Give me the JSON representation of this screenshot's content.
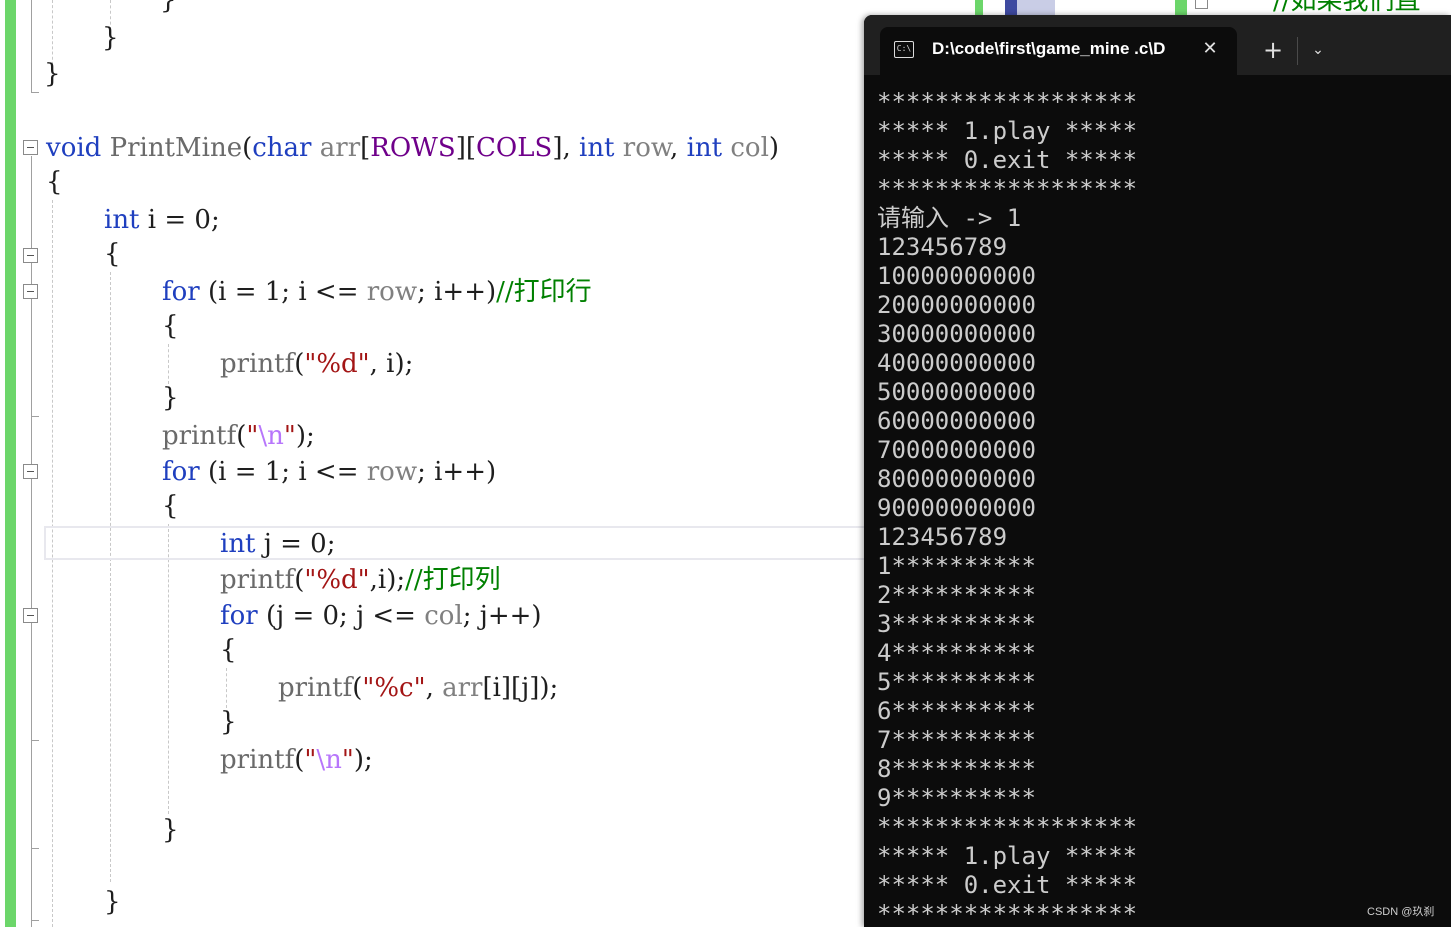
{
  "editor": {
    "lines": [
      [
        {
          "t": "}",
          "c": "p"
        }
      ],
      [
        {
          "t": "}",
          "c": "p"
        }
      ],
      [
        {
          "t": "}",
          "c": "p"
        }
      ],
      [
        {
          "t": "void",
          "c": "kw"
        },
        {
          "t": " ",
          "c": "p"
        },
        {
          "t": "PrintMine",
          "c": "fn"
        },
        {
          "t": "(",
          "c": "p"
        },
        {
          "t": "char",
          "c": "kw"
        },
        {
          "t": " ",
          "c": "p"
        },
        {
          "t": "arr",
          "c": "va"
        },
        {
          "t": "[",
          "c": "p"
        },
        {
          "t": "ROWS",
          "c": "mac"
        },
        {
          "t": "][",
          "c": "p"
        },
        {
          "t": "COLS",
          "c": "mac"
        },
        {
          "t": "], ",
          "c": "p"
        },
        {
          "t": "int",
          "c": "kw"
        },
        {
          "t": " ",
          "c": "p"
        },
        {
          "t": "row",
          "c": "va"
        },
        {
          "t": ", ",
          "c": "p"
        },
        {
          "t": "int",
          "c": "kw"
        },
        {
          "t": " ",
          "c": "p"
        },
        {
          "t": "col",
          "c": "va"
        },
        {
          "t": ")",
          "c": "p"
        }
      ],
      [
        {
          "t": "{",
          "c": "p"
        }
      ],
      [
        {
          "t": "int",
          "c": "kw"
        },
        {
          "t": " i = 0;",
          "c": "p"
        }
      ],
      [
        {
          "t": "{",
          "c": "p"
        }
      ],
      [
        {
          "t": "for",
          "c": "kw"
        },
        {
          "t": " (i = 1; i <= ",
          "c": "p"
        },
        {
          "t": "row",
          "c": "va"
        },
        {
          "t": "; i++)",
          "c": "p"
        },
        {
          "t": "//打印行",
          "c": "cm"
        }
      ],
      [
        {
          "t": "{",
          "c": "p"
        }
      ],
      [
        {
          "t": "printf",
          "c": "fn"
        },
        {
          "t": "(",
          "c": "p"
        },
        {
          "t": "\"%d\"",
          "c": "st"
        },
        {
          "t": ", i);",
          "c": "p"
        }
      ],
      [
        {
          "t": "}",
          "c": "p"
        }
      ],
      [
        {
          "t": "printf",
          "c": "fn"
        },
        {
          "t": "(",
          "c": "p"
        },
        {
          "t": "\"",
          "c": "st"
        },
        {
          "t": "\\n",
          "c": "esc"
        },
        {
          "t": "\"",
          "c": "st"
        },
        {
          "t": ");",
          "c": "p"
        }
      ],
      [
        {
          "t": "for",
          "c": "kw"
        },
        {
          "t": " (i = 1; i <= ",
          "c": "p"
        },
        {
          "t": "row",
          "c": "va"
        },
        {
          "t": "; i++)",
          "c": "p"
        }
      ],
      [
        {
          "t": "{",
          "c": "p"
        }
      ],
      [
        {
          "t": "int",
          "c": "kw"
        },
        {
          "t": " j = 0;",
          "c": "p"
        }
      ],
      [
        {
          "t": "printf",
          "c": "fn"
        },
        {
          "t": "(",
          "c": "p"
        },
        {
          "t": "\"%d\"",
          "c": "st"
        },
        {
          "t": ",i);",
          "c": "p"
        },
        {
          "t": "//打印列",
          "c": "cm"
        }
      ],
      [
        {
          "t": "for",
          "c": "kw"
        },
        {
          "t": " (j = 0; j <= ",
          "c": "p"
        },
        {
          "t": "col",
          "c": "va"
        },
        {
          "t": "; j++)",
          "c": "p"
        }
      ],
      [
        {
          "t": "{",
          "c": "p"
        }
      ],
      [
        {
          "t": "printf",
          "c": "fn"
        },
        {
          "t": "(",
          "c": "p"
        },
        {
          "t": "\"%c\"",
          "c": "st"
        },
        {
          "t": ", ",
          "c": "p"
        },
        {
          "t": "arr",
          "c": "va"
        },
        {
          "t": "[i][j]);",
          "c": "p"
        }
      ],
      [
        {
          "t": "}",
          "c": "p"
        }
      ],
      [
        {
          "t": "printf",
          "c": "fn"
        },
        {
          "t": "(",
          "c": "p"
        },
        {
          "t": "\"",
          "c": "st"
        },
        {
          "t": "\\n",
          "c": "esc"
        },
        {
          "t": "\"",
          "c": "st"
        },
        {
          "t": ");",
          "c": "p"
        }
      ],
      [
        {
          "t": "}",
          "c": "p"
        }
      ],
      [
        {
          "t": "}",
          "c": "p"
        }
      ]
    ],
    "background_comment": "//如果我们直",
    "colors": {
      "keyword": "#1f3fbf",
      "function": "#6a6a6a",
      "variable": "#808080",
      "macro": "#6f008a",
      "string": "#a31515",
      "escape": "#b776fb",
      "comment": "#008000",
      "change_bar": "#6cd66a"
    }
  },
  "terminal": {
    "tab_title": "D:\\code\\first\\game_mine .c\\D",
    "tab_icon": "terminal-icon",
    "close_glyph": "✕",
    "new_tab_glyph": "+",
    "dropdown_glyph": "⌄",
    "output": [
      "******************",
      "***** 1.play *****",
      "***** 0.exit *****",
      "******************",
      "请输入 -> 1",
      "123456789",
      "10000000000",
      "20000000000",
      "30000000000",
      "40000000000",
      "50000000000",
      "60000000000",
      "70000000000",
      "80000000000",
      "90000000000",
      "123456789",
      "1**********",
      "2**********",
      "3**********",
      "4**********",
      "5**********",
      "6**********",
      "7**********",
      "8**********",
      "9**********",
      "******************",
      "***** 1.play *****",
      "***** 0.exit *****",
      "******************"
    ]
  },
  "watermark": "CSDN @玖刹"
}
